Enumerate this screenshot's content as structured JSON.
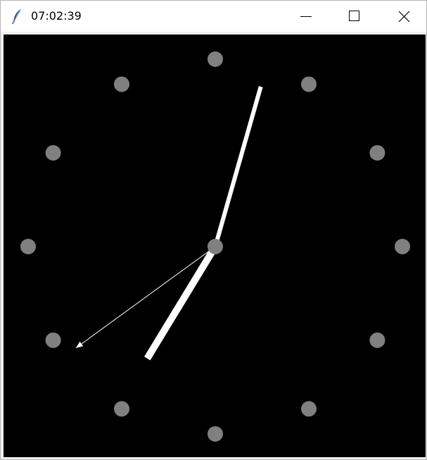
{
  "window": {
    "title": "07:02:39",
    "controls": {
      "minimize": "minimize",
      "maximize": "maximize",
      "close": "close"
    }
  },
  "icons": {
    "app": "feather-icon",
    "minimize": "minimize-icon",
    "maximize": "maximize-icon",
    "close": "close-icon"
  },
  "clock": {
    "time": {
      "hours": 7,
      "minutes": 2,
      "seconds": 39
    },
    "hour_markers": 12,
    "colors": {
      "background": "#000000",
      "markers": "#808080",
      "hands": "#ffffff"
    }
  }
}
